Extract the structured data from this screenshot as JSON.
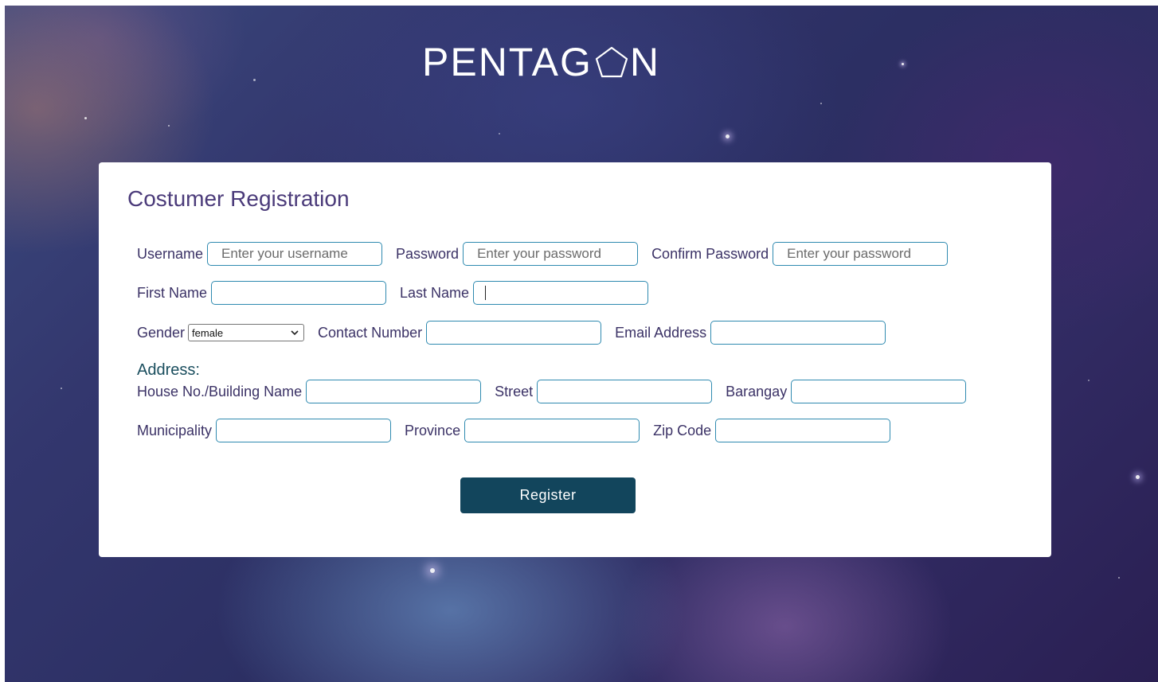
{
  "brand": {
    "logo_before": "PENTAG",
    "logo_after": "N"
  },
  "form": {
    "title": "Costumer Registration",
    "address_heading": "Address:",
    "fields": {
      "username": {
        "label": "Username",
        "placeholder": "Enter your username"
      },
      "password": {
        "label": "Password",
        "placeholder": "Enter your password"
      },
      "confirm_password": {
        "label": "Confirm Password",
        "placeholder": "Enter your password"
      },
      "first_name": {
        "label": "First Name",
        "placeholder": ""
      },
      "last_name": {
        "label": "Last Name",
        "placeholder": ""
      },
      "gender": {
        "label": "Gender",
        "selected": "female"
      },
      "contact_number": {
        "label": "Contact Number",
        "placeholder": ""
      },
      "email_address": {
        "label": "Email Address",
        "placeholder": ""
      },
      "house_no": {
        "label": "House No./Building Name",
        "placeholder": ""
      },
      "street": {
        "label": "Street",
        "placeholder": ""
      },
      "barangay": {
        "label": "Barangay",
        "placeholder": ""
      },
      "municipality": {
        "label": "Municipality",
        "placeholder": ""
      },
      "province": {
        "label": "Province",
        "placeholder": ""
      },
      "zip_code": {
        "label": "Zip Code",
        "placeholder": ""
      }
    },
    "register_label": "Register"
  },
  "colors": {
    "title": "#4b3b7a",
    "label": "#3b3266",
    "input_border": "#2f8ab0",
    "button": "#12455c",
    "address_heading": "#1a4e5e"
  },
  "icons": {
    "logo_o": "pentagon-icon",
    "select_arrow": "chevron-down-icon"
  }
}
